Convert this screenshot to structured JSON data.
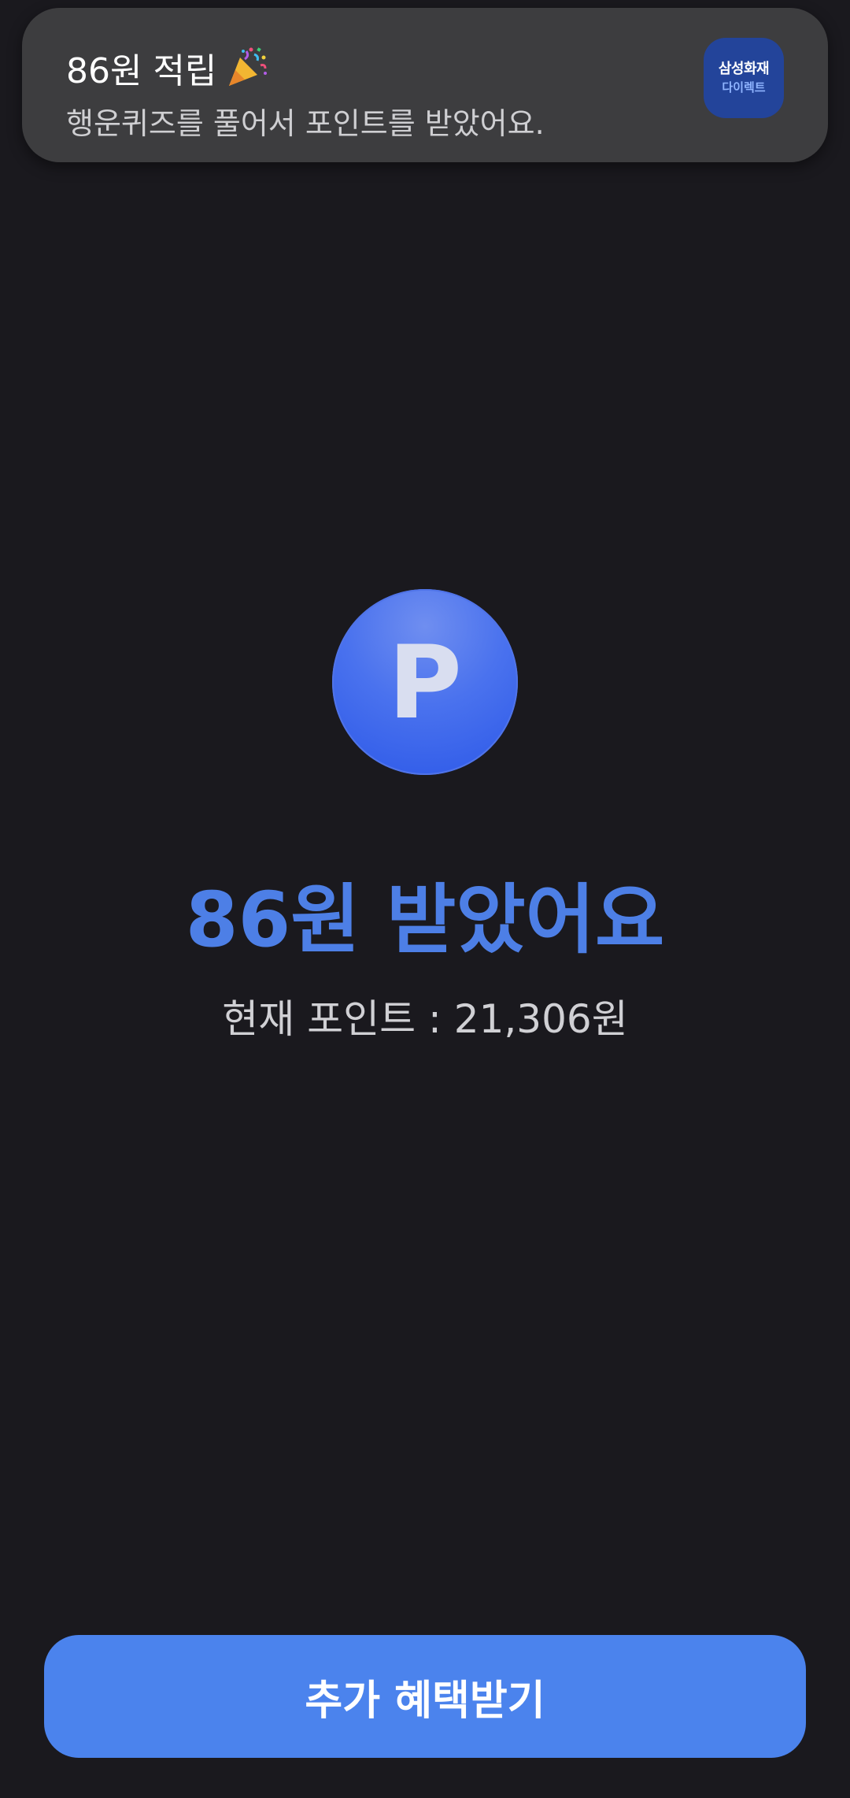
{
  "toast": {
    "title": "86원 적립",
    "title_icon": "party-popper-icon",
    "message": "행운퀴즈를 풀어서 포인트를 받았어요.",
    "app_logo": {
      "line1": "삼성화재",
      "line2": "다이렉트",
      "color": "#23449a"
    }
  },
  "reward": {
    "icon_letter": "P",
    "headline": "86원 받았어요",
    "current_points": "현재 포인트 : 21,306원"
  },
  "cta": {
    "label": "추가 혜택받기"
  },
  "colors": {
    "background": "#1a191e",
    "accent": "#4b83ed",
    "headline": "#4d7fe6"
  }
}
